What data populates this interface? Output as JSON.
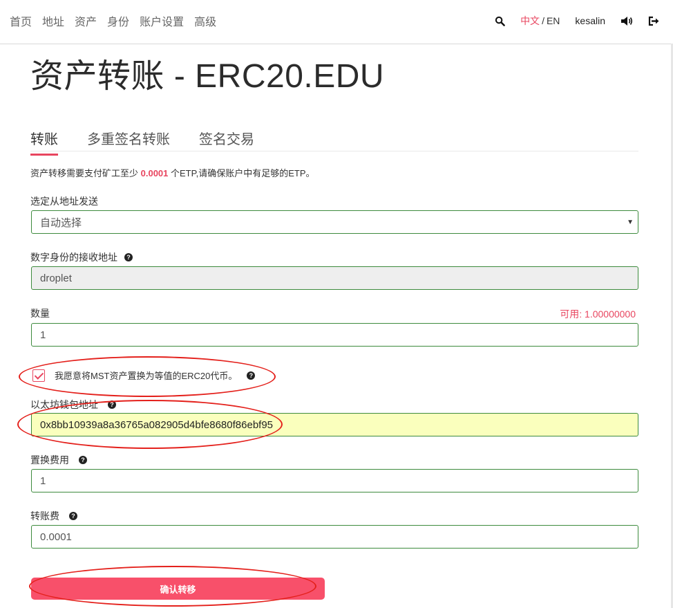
{
  "nav": {
    "items": [
      "首页",
      "地址",
      "资产",
      "身份",
      "账户设置",
      "高级"
    ],
    "lang_cn": "中文",
    "lang_sep": "/",
    "lang_en": "EN",
    "username": "kesalin",
    "icons": [
      "search-icon",
      "volume-icon",
      "logout-icon"
    ]
  },
  "page": {
    "title": "资产转账 - ERC20.EDU"
  },
  "tabs": [
    "转账",
    "多重签名转账",
    "签名交易"
  ],
  "notice": {
    "before": "资产转移需要支付矿工至少 ",
    "fee": "0.0001",
    "after": " 个ETP,请确保账户中有足够的ETP。"
  },
  "form": {
    "from_label": "选定从地址发送",
    "from_value": "自动选择",
    "recipient_label": "数字身份的接收地址",
    "recipient_value": "droplet",
    "amount_label": "数量",
    "available": "可用: 1.00000000",
    "amount_value": "1",
    "swap_checkbox_label": "我愿意将MST资产置换为等值的ERC20代币。",
    "swap_checked": true,
    "eth_label": "以太坊钱包地址",
    "eth_value": "0x8bb10939a8a36765a082905d4bfe8680f86ebf95",
    "swap_fee_label": "置换费用",
    "swap_fee_value": "1",
    "tx_fee_label": "转账费",
    "tx_fee_value": "0.0001",
    "confirm_label": "确认转移"
  },
  "colors": {
    "accent": "#e8455f",
    "button": "#f8506a",
    "field_border": "#3c8a3c",
    "autofill": "#faffbd",
    "annotation": "#e4201b"
  }
}
